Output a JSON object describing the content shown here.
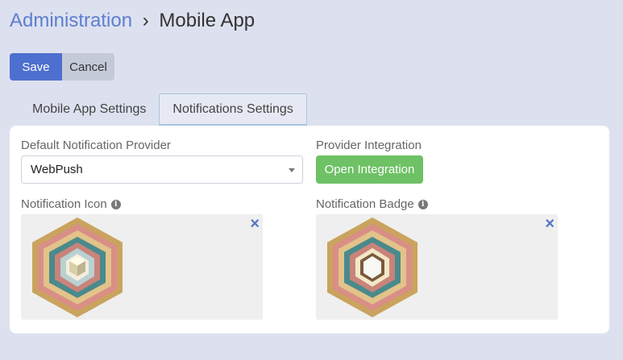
{
  "breadcrumb": {
    "parent": "Administration",
    "separator": "›",
    "current": "Mobile App"
  },
  "actions": {
    "save": "Save",
    "cancel": "Cancel"
  },
  "tabs": [
    {
      "label": "Mobile App Settings",
      "active": false
    },
    {
      "label": "Notifications Settings",
      "active": true
    }
  ],
  "form": {
    "provider_label": "Default Notification Provider",
    "provider_value": "WebPush",
    "integration_label": "Provider Integration",
    "integration_button": "Open Integration",
    "icon_label": "Notification Icon",
    "badge_label": "Notification Badge",
    "info_glyph": "i",
    "remove_glyph": "×"
  },
  "colors": {
    "accent": "#4d6fcf",
    "success": "#6ec165",
    "background": "#dde1ef"
  }
}
